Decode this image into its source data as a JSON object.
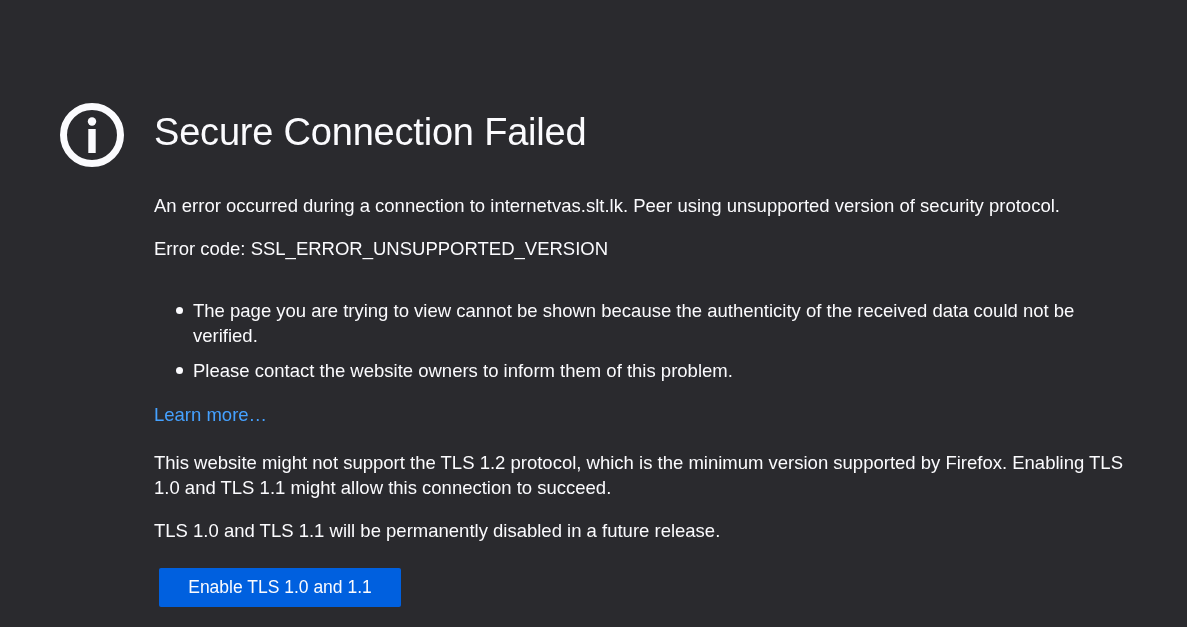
{
  "title": "Secure Connection Failed",
  "short_description": "An error occurred during a connection to internetvas.slt.lk. Peer using unsupported version of security protocol.",
  "error_code": "Error code: SSL_ERROR_UNSUPPORTED_VERSION",
  "details": [
    "The page you are trying to view cannot be shown because the authenticity of the received data could not be verified.",
    "Please contact the website owners to inform them of this problem."
  ],
  "learn_more_link": "Learn more…",
  "tls_notes": [
    "This website might not support the TLS 1.2 protocol, which is the minimum version supported by Firefox. Enabling TLS 1.0 and TLS 1.1 might allow this connection to succeed.",
    "TLS 1.0 and TLS 1.1 will be permanently disabled in a future release."
  ],
  "button": "Enable TLS 1.0 and 1.1"
}
